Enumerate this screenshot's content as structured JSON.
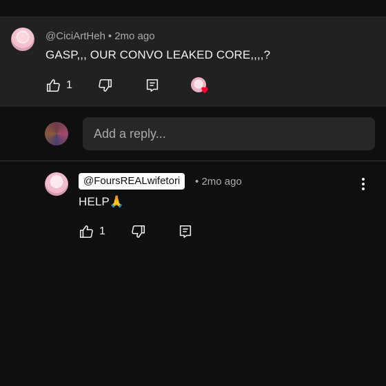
{
  "header": {
    "title_partial": ""
  },
  "comment": {
    "handle": "@CiciArtHeh",
    "time": "2mo ago",
    "text": "GASP,,, OUR CONVO LEAKED CORE,,,,?",
    "likes": "1"
  },
  "reply_box": {
    "placeholder": "Add a reply..."
  },
  "reply": {
    "handle": "@FoursREALwifetori",
    "time": "2mo ago",
    "text": "HELP🙏",
    "likes": "1"
  },
  "separator": "•",
  "colors": {
    "bg": "#0f0f0f",
    "comment_bg": "#212121",
    "reply_box": "#272727",
    "heart": "#ff0033"
  }
}
